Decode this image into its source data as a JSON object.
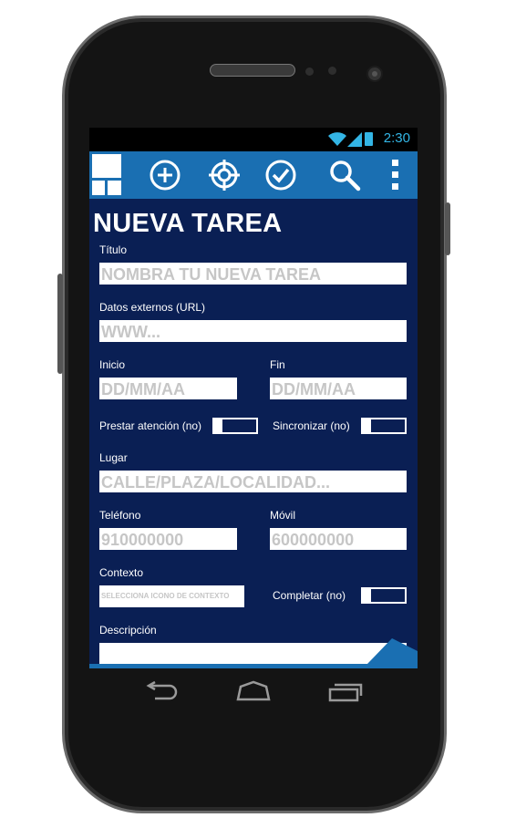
{
  "status_bar": {
    "time": "2:30"
  },
  "header": {
    "title": "NUEVA TAREA"
  },
  "form": {
    "titulo": {
      "label": "Título",
      "placeholder": "NOMBRA TU NUEVA TAREA"
    },
    "url": {
      "label": "Datos externos (URL)",
      "placeholder": "WWW..."
    },
    "inicio": {
      "label": "Inicio",
      "placeholder": "DD/MM/AA"
    },
    "fin": {
      "label": "Fin",
      "placeholder": "DD/MM/AA"
    },
    "prestar_atencion": {
      "label": "Prestar atención (no)"
    },
    "sincronizar": {
      "label": "Sincronizar (no)"
    },
    "lugar": {
      "label": "Lugar",
      "placeholder": "CALLE/PLAZA/LOCALIDAD..."
    },
    "telefono": {
      "label": "Teléfono",
      "placeholder": "910000000"
    },
    "movil": {
      "label": "Móvil",
      "placeholder": "600000000"
    },
    "contexto": {
      "label": "Contexto",
      "placeholder": "SELECCIONA ICONO DE CONTEXTO"
    },
    "completar": {
      "label": "Completar (no)"
    },
    "descripcion": {
      "label": "Descripción"
    }
  },
  "icons": {
    "action_bar": [
      "app-logo-icon",
      "add-icon",
      "target-icon",
      "check-icon",
      "search-icon",
      "overflow-menu-icon"
    ],
    "nav_bar": [
      "back-icon",
      "home-icon",
      "recent-apps-icon"
    ]
  },
  "colors": {
    "action_bar": "#1a6fb2",
    "content_bg": "#0a1f54",
    "status_accent": "#33b5e5"
  }
}
